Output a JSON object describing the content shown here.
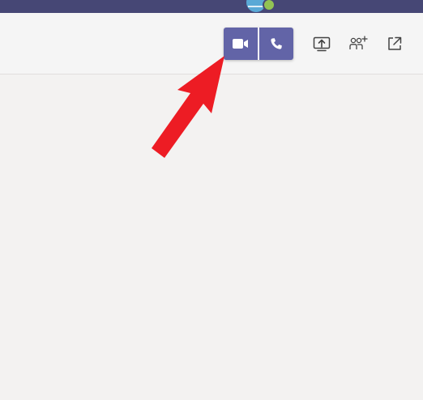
{
  "colors": {
    "titlebar": "#464775",
    "accent": "#6264a7",
    "toolbar_bg": "#f5f5f5",
    "content_bg": "#f3f2f1",
    "annotation_arrow": "#ed1c24",
    "presence": "#92c353"
  },
  "titlebar": {
    "avatar_icon": "globe-avatar-icon",
    "presence_status": "available"
  },
  "toolbar": {
    "call_buttons": [
      {
        "name": "video-call-button",
        "icon": "video-camera-icon"
      },
      {
        "name": "audio-call-button",
        "icon": "phone-icon"
      }
    ],
    "actions": [
      {
        "name": "share-screen-button",
        "icon": "share-screen-icon"
      },
      {
        "name": "add-people-button",
        "icon": "add-people-icon"
      },
      {
        "name": "pop-out-button",
        "icon": "pop-out-icon"
      }
    ]
  },
  "annotation": {
    "type": "arrow",
    "points_to": "video-call-button"
  }
}
